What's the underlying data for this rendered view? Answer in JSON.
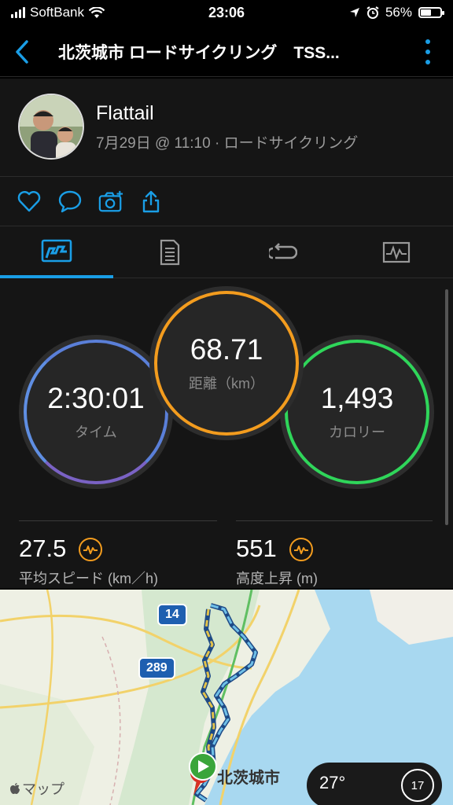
{
  "status_bar": {
    "carrier": "SoftBank",
    "time": "23:06",
    "battery_percent": "56%",
    "battery_level": 0.56
  },
  "header": {
    "title": "北茨城市 ロードサイクリング　TSS..."
  },
  "profile": {
    "name": "Flattail",
    "meta": "7月29日 @ 11:10 · ロードサイクリング"
  },
  "actions": [
    "heart-icon",
    "comment-icon",
    "camera-icon",
    "share-icon"
  ],
  "tabs": [
    {
      "icon": "overview-icon",
      "active": true
    },
    {
      "icon": "details-icon",
      "active": false
    },
    {
      "icon": "laps-icon",
      "active": false
    },
    {
      "icon": "chart-icon",
      "active": false
    }
  ],
  "metrics": {
    "time": {
      "value": "2:30:01",
      "label": "タイム"
    },
    "distance": {
      "value": "68.71",
      "label": "距離（km）"
    },
    "calories": {
      "value": "1,493",
      "label": "カロリー"
    }
  },
  "stats": {
    "avg_speed": {
      "value": "27.5",
      "label": "平均スピード (km／h)"
    },
    "elevation_gain": {
      "value": "551",
      "label": "高度上昇 (m)"
    }
  },
  "map": {
    "city": "北茨城市",
    "route_14": "14",
    "route_289": "289",
    "maps_label": "マップ",
    "temperature": "27°",
    "wind_speed": "17"
  },
  "colors": {
    "accent": "#1a9ee6",
    "time_ring": "#5a7fd8",
    "distance_ring": "#f39c1e",
    "calories_ring": "#2fd65a",
    "icon_orange": "#f39c1e"
  }
}
